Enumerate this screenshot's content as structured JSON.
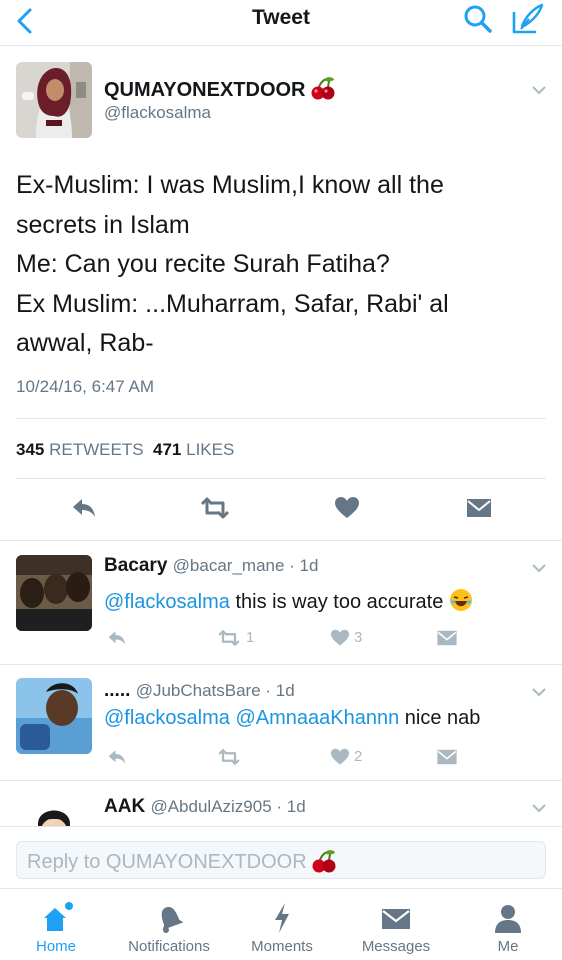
{
  "header": {
    "title": "Tweet"
  },
  "tweet": {
    "display_name": "QUMAYONEXTDOOR",
    "handle": "@flackosalma",
    "text_lines": [
      "Ex-Muslim: I was Muslim,I know all the",
      "secrets in Islam",
      "Me: Can you recite Surah Fatiha?",
      "Ex Muslim: ...Muharram, Safar, Rabi' al",
      "awwal, Rab-"
    ],
    "timestamp": "10/24/16, 6:47 AM",
    "retweet_count": "345",
    "retweet_label": "RETWEETS",
    "like_count": "471",
    "like_label": "LIKES"
  },
  "replies": [
    {
      "name": "Bacary",
      "handle": "@bacar_mane",
      "time": "1d",
      "mention": "@flackosalma",
      "text": "this is way too accurate",
      "retweets": "1",
      "likes": "3"
    },
    {
      "name": ".....",
      "handle": "@JubChatsBare",
      "time": "1d",
      "mention": "@flackosalma @AmnaaaKhannn",
      "text": "nice nab",
      "retweets": "",
      "likes": "2"
    },
    {
      "name": "AAK",
      "handle": "@AbdulAziz905",
      "time": "1d"
    }
  ],
  "composer": {
    "placeholder": "Reply to QUMAYONEXTDOOR"
  },
  "tabs": [
    {
      "label": "Home",
      "icon": "home-icon",
      "active": true
    },
    {
      "label": "Notifications",
      "icon": "bell-icon",
      "active": false
    },
    {
      "label": "Moments",
      "icon": "lightning-icon",
      "active": false
    },
    {
      "label": "Messages",
      "icon": "envelope-icon",
      "active": false
    },
    {
      "label": "Me",
      "icon": "person-icon",
      "active": false
    }
  ],
  "colors": {
    "accent": "#1da1f2",
    "link": "#1b95e0",
    "muted": "#657786",
    "divider": "#e1e8ed",
    "cherry": "#d0021b"
  }
}
